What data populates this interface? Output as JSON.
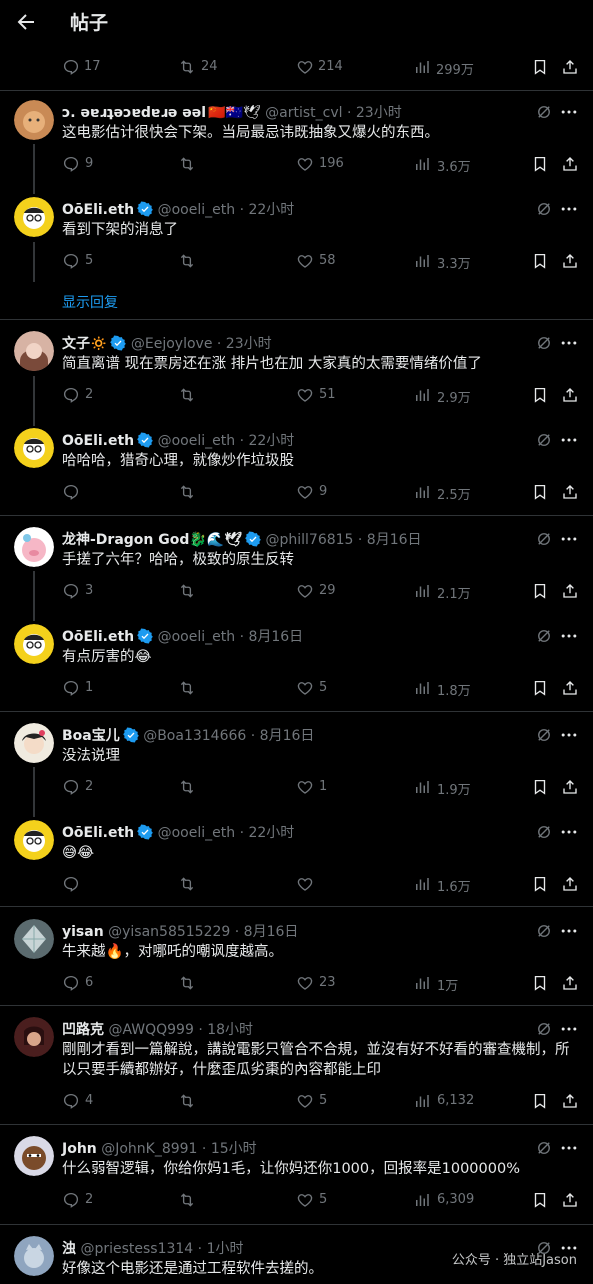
{
  "header": {
    "title": "帖子"
  },
  "top_actions": {
    "replies": "17",
    "reposts": "24",
    "likes": "214",
    "views": "299万"
  },
  "posts": [
    {
      "name": "ɔ. ǝɐɹʇǝɔɐdɐɹǝ ǝǝl",
      "handle": "@artist_cvl",
      "time": "· 23小时",
      "flags": "🇨🇳🇦🇺🕊",
      "text": "这电影估计很快会下架。当局最忌讳既抽象又爆火的东西。",
      "replies": "9",
      "reposts": "",
      "likes": "196",
      "views": "3.6万"
    },
    {
      "name": "OōEli.eth",
      "handle": "@ooeli_eth",
      "time": "· 22小时",
      "text": "看到下架的消息了",
      "replies": "5",
      "reposts": "",
      "likes": "58",
      "views": "3.3万"
    },
    {
      "show_replies": "显示回复"
    },
    {
      "name": "文子🔅",
      "handle": "@Eejoylove",
      "time": "· 23小时",
      "text": "简直离谱 现在票房还在涨 排片也在加 大家真的太需要情绪价值了",
      "replies": "2",
      "reposts": "",
      "likes": "51",
      "views": "2.9万"
    },
    {
      "name": "OōEli.eth",
      "handle": "@ooeli_eth",
      "time": "· 22小时",
      "text": "哈哈哈，猎奇心理，就像炒作垃圾股",
      "replies": "",
      "reposts": "",
      "likes": "9",
      "views": "2.5万"
    },
    {
      "name": "龙神-Dragon God🐉🌊🕊",
      "handle": "@phill76815",
      "time": "· 8月16日",
      "text": "手搓了六年？哈哈，极致的原生反转",
      "replies": "3",
      "reposts": "",
      "likes": "29",
      "views": "2.1万"
    },
    {
      "name": "OōEli.eth",
      "handle": "@ooeli_eth",
      "time": "· 8月16日",
      "text": "有点厉害的😂",
      "replies": "1",
      "reposts": "",
      "likes": "5",
      "views": "1.8万"
    },
    {
      "name": "Boa宝儿",
      "handle": "@Boa1314666",
      "time": "· 8月16日",
      "text": "没法说理",
      "replies": "2",
      "reposts": "",
      "likes": "1",
      "views": "1.9万"
    },
    {
      "name": "OōEli.eth",
      "handle": "@ooeli_eth",
      "time": "· 22小时",
      "text": "😅😂",
      "replies": "",
      "reposts": "",
      "likes": "",
      "views": "1.6万"
    },
    {
      "name": "yisan",
      "handle": "@yisan58515229",
      "time": "· 8月16日",
      "text": "牛来越🔥，对哪吒的嘲讽度越高。",
      "replies": "6",
      "reposts": "",
      "likes": "23",
      "views": "1万"
    },
    {
      "name": "凹路克",
      "handle": "@AWQQ999",
      "time": "· 18小时",
      "text": "剛剛才看到一篇解說，講說電影只管合不合規，並沒有好不好看的審查機制，所以只要手續都辦好，什麼歪瓜劣棗的內容都能上印",
      "replies": "4",
      "reposts": "",
      "likes": "5",
      "views": "6,132"
    },
    {
      "name": "John",
      "handle": "@JohnK_8991",
      "time": "· 15小时",
      "text": "什么弱智逻辑，你给你妈1毛，让你妈还你1000，回报率是1000000%",
      "replies": "2",
      "reposts": "",
      "likes": "5",
      "views": "6,309"
    },
    {
      "name": "浊",
      "handle": "@priestess1314",
      "time": "· 1小时",
      "text": "好像这个电影还是通过工程软件去搓的。"
    }
  ],
  "watermark": "公众号 · 独立站Jason",
  "colors": {
    "background": "#000000",
    "text": "#e7e9ea",
    "muted": "#71767b",
    "accent": "#1d9bf0",
    "divider": "#2f3336"
  }
}
